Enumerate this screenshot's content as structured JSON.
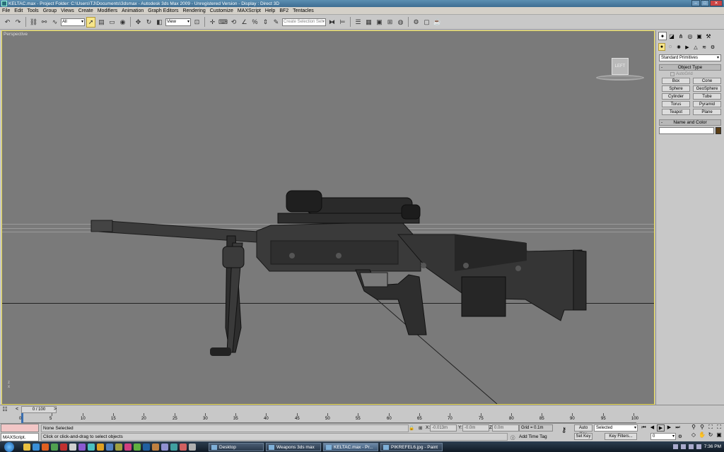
{
  "window": {
    "title": "KELTAC.max    - Project Folder: C:\\Users\\TJ\\Documents\\3dsmax    - Autodesk 3ds Max  2009    - Unregistered Version    - Display : Direct 3D"
  },
  "menu": [
    "File",
    "Edit",
    "Tools",
    "Group",
    "Views",
    "Create",
    "Modifiers",
    "Animation",
    "Graph Editors",
    "Rendering",
    "Customize",
    "MAXScript",
    "Help",
    "BF2",
    "Tentacles"
  ],
  "toolbar": {
    "selection_filter": "All",
    "reference_coord": "View",
    "named_selection_placeholder": "Create Selection Set"
  },
  "viewport": {
    "label": "Perspective",
    "viewcube_face": "LEFT",
    "axis_z": "z",
    "axis_x": "x"
  },
  "command_panel": {
    "category": "Standard Primitives",
    "object_type_title": "Object Type",
    "autogrid": "AutoGrid",
    "objects": [
      "Box",
      "Cone",
      "Sphere",
      "GeoSphere",
      "Cylinder",
      "Tube",
      "Torus",
      "Pyramid",
      "Teapot",
      "Plane"
    ],
    "name_color_title": "Name and Color",
    "color": "#5a3d14"
  },
  "timeline": {
    "frame_display": "0 / 100",
    "ticks": [
      "0",
      "5",
      "10",
      "15",
      "20",
      "25",
      "30",
      "35",
      "40",
      "45",
      "50",
      "55",
      "60",
      "65",
      "70",
      "75",
      "80",
      "85",
      "90",
      "95",
      "100"
    ]
  },
  "status": {
    "listener_text": "MAXScript.",
    "selection_status": "None Selected",
    "prompt": "Click or click-and-drag to select objects",
    "x_label": "X:",
    "x_value": "-0.013m",
    "y_label": "Y:",
    "y_value": "-0.0m",
    "z_label": "Z:",
    "z_value": "0.0m",
    "grid": "Grid = 0.1m",
    "add_time_tag": "Add Time Tag",
    "auto_key": "Auto Key",
    "set_key": "Set Key",
    "key_mode": "Selected",
    "key_filters": "Key Filters...",
    "frame_value": "0"
  },
  "taskbar": {
    "tasks": [
      "Desktop",
      "Weapons 3ds max",
      "KELTAC.max - Pr...",
      "PIKREFEL6.jpg - Paint"
    ],
    "active_index": 2,
    "clock": "7:36 PM"
  }
}
